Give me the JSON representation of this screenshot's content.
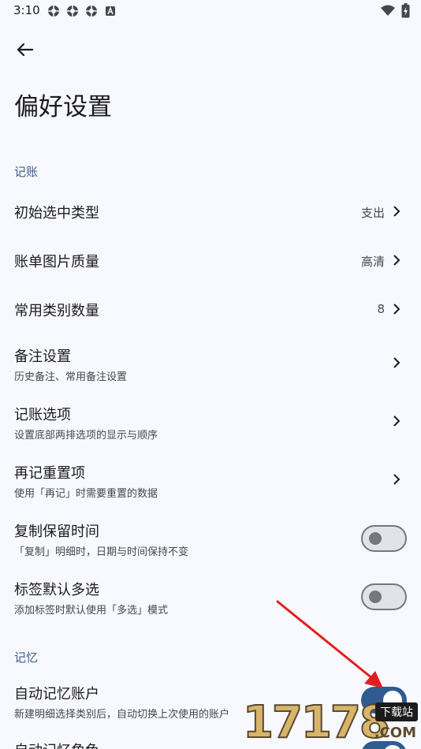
{
  "status_bar": {
    "time": "3:10",
    "notification_icons": [
      "app-icon",
      "app-icon",
      "app-icon",
      "a-icon"
    ],
    "wifi_icon": "wifi-icon",
    "battery_icon": "battery-charging-icon"
  },
  "nav": {
    "back_icon": "back-arrow-icon"
  },
  "page": {
    "title": "偏好设置"
  },
  "sections": {
    "bookkeeping": "记账",
    "memory": "记忆"
  },
  "rows": {
    "initial_type": {
      "title": "初始选中类型",
      "value": "支出"
    },
    "image_quality": {
      "title": "账单图片质量",
      "value": "高清"
    },
    "common_category_count": {
      "title": "常用类别数量",
      "value": "8"
    },
    "remark_settings": {
      "title": "备注设置",
      "subtitle": "历史备注、常用备注设置"
    },
    "bookkeeping_options": {
      "title": "记账选项",
      "subtitle": "设置底部两排选项的显示与顺序"
    },
    "re_record_reset": {
      "title": "再记重置项",
      "subtitle": "使用「再记」时需要重置的数据"
    },
    "copy_keep_time": {
      "title": "复制保留时间",
      "subtitle": "「复制」明细时，日期与时间保持不变",
      "toggle": false
    },
    "tag_default_multi": {
      "title": "标签默认多选",
      "subtitle": "添加标签时默认使用「多选」模式",
      "toggle": false
    },
    "auto_remember_account": {
      "title": "自动记忆账户",
      "subtitle": "新建明细选择类别后，自动切换上次使用的账户",
      "toggle": true
    },
    "auto_remember_role": {
      "title": "自动记忆角色"
    }
  },
  "colors": {
    "background": "#F8F9FE",
    "accent": "#2F5B8F",
    "section_header": "#3D5A8C",
    "annotation_arrow": "#E02020"
  },
  "watermark": {
    "text": "17178",
    "badge": "下载站",
    "suffix": ".COM"
  }
}
